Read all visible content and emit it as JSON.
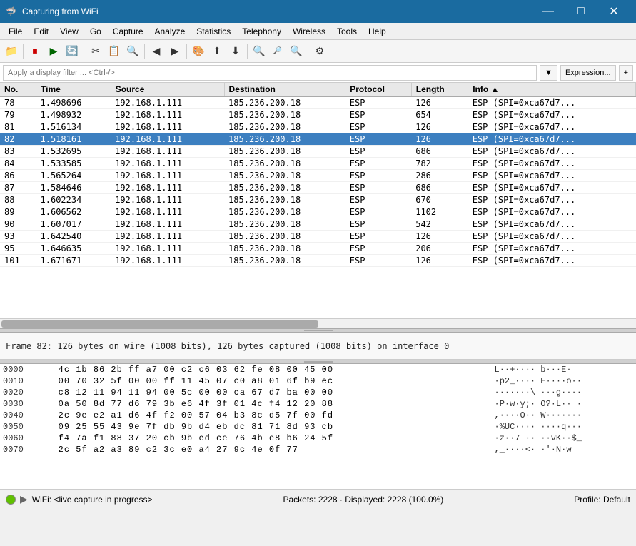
{
  "titlebar": {
    "icon": "🦈",
    "title": "Capturing from WiFi",
    "minimize": "—",
    "maximize": "□",
    "close": "✕"
  },
  "menubar": {
    "items": [
      "File",
      "Edit",
      "View",
      "Go",
      "Capture",
      "Analyze",
      "Statistics",
      "Telephony",
      "Wireless",
      "Tools",
      "Help"
    ]
  },
  "toolbar": {
    "buttons": [
      "📁",
      "⏹",
      "▶",
      "🔄",
      "✂",
      "📋",
      "🔍",
      "⬅",
      "➡",
      "📊",
      "⬆",
      "⬇",
      "📄",
      "◀▶",
      "🔎",
      "🔎",
      "🔎",
      "⚙"
    ]
  },
  "filterbar": {
    "placeholder": "Apply a display filter ... <Ctrl-/>",
    "dropdown_label": "▼",
    "expression_label": "Expression...",
    "plus_label": "+"
  },
  "table": {
    "columns": [
      "No.",
      "Time",
      "Source",
      "Destination",
      "Protocol",
      "Length",
      "Info"
    ],
    "rows": [
      {
        "no": "78",
        "time": "1.498696",
        "src": "192.168.1.111",
        "dst": "185.236.200.18",
        "proto": "ESP",
        "len": "126",
        "info": "ESP (SPI=0xca67d7...",
        "selected": false
      },
      {
        "no": "79",
        "time": "1.498932",
        "src": "192.168.1.111",
        "dst": "185.236.200.18",
        "proto": "ESP",
        "len": "654",
        "info": "ESP (SPI=0xca67d7...",
        "selected": false
      },
      {
        "no": "81",
        "time": "1.516134",
        "src": "192.168.1.111",
        "dst": "185.236.200.18",
        "proto": "ESP",
        "len": "126",
        "info": "ESP (SPI=0xca67d7...",
        "selected": false
      },
      {
        "no": "82",
        "time": "1.518161",
        "src": "192.168.1.111",
        "dst": "185.236.200.18",
        "proto": "ESP",
        "len": "126",
        "info": "ESP (SPI=0xca67d7...",
        "selected": true
      },
      {
        "no": "83",
        "time": "1.532695",
        "src": "192.168.1.111",
        "dst": "185.236.200.18",
        "proto": "ESP",
        "len": "686",
        "info": "ESP (SPI=0xca67d7...",
        "selected": false
      },
      {
        "no": "84",
        "time": "1.533585",
        "src": "192.168.1.111",
        "dst": "185.236.200.18",
        "proto": "ESP",
        "len": "782",
        "info": "ESP (SPI=0xca67d7...",
        "selected": false
      },
      {
        "no": "86",
        "time": "1.565264",
        "src": "192.168.1.111",
        "dst": "185.236.200.18",
        "proto": "ESP",
        "len": "286",
        "info": "ESP (SPI=0xca67d7...",
        "selected": false
      },
      {
        "no": "87",
        "time": "1.584646",
        "src": "192.168.1.111",
        "dst": "185.236.200.18",
        "proto": "ESP",
        "len": "686",
        "info": "ESP (SPI=0xca67d7...",
        "selected": false
      },
      {
        "no": "88",
        "time": "1.602234",
        "src": "192.168.1.111",
        "dst": "185.236.200.18",
        "proto": "ESP",
        "len": "670",
        "info": "ESP (SPI=0xca67d7...",
        "selected": false
      },
      {
        "no": "89",
        "time": "1.606562",
        "src": "192.168.1.111",
        "dst": "185.236.200.18",
        "proto": "ESP",
        "len": "1102",
        "info": "ESP (SPI=0xca67d7...",
        "selected": false
      },
      {
        "no": "90",
        "time": "1.607017",
        "src": "192.168.1.111",
        "dst": "185.236.200.18",
        "proto": "ESP",
        "len": "542",
        "info": "ESP (SPI=0xca67d7...",
        "selected": false
      },
      {
        "no": "93",
        "time": "1.642540",
        "src": "192.168.1.111",
        "dst": "185.236.200.18",
        "proto": "ESP",
        "len": "126",
        "info": "ESP (SPI=0xca67d7...",
        "selected": false
      },
      {
        "no": "95",
        "time": "1.646635",
        "src": "192.168.1.111",
        "dst": "185.236.200.18",
        "proto": "ESP",
        "len": "206",
        "info": "ESP (SPI=0xca67d7...",
        "selected": false
      },
      {
        "no": "101",
        "time": "1.671671",
        "src": "192.168.1.111",
        "dst": "185.236.200.18",
        "proto": "ESP",
        "len": "126",
        "info": "ESP (SPI=0xca67d7...",
        "selected": false
      }
    ]
  },
  "frame_detail": "Frame 82: 126 bytes on wire (1008 bits), 126 bytes captured (1008 bits) on interface 0",
  "hex": {
    "rows": [
      {
        "offset": "0000",
        "bytes": "4c 1b 86 2b ff a7 00 c2  c6 03 62 fe 08 00 45 00",
        "ascii": "L··+····  b···E·"
      },
      {
        "offset": "0010",
        "bytes": "00 70 32 5f 00 00 ff 11  45 07 c0 a8 01 6f b9 ec",
        "ascii": "·p2_····  E····o··"
      },
      {
        "offset": "0020",
        "bytes": "c8 12 11 94 11 94 00 5c  00 00 ca 67 d7 ba 00 00",
        "ascii": "·······\\  ···g····"
      },
      {
        "offset": "0030",
        "bytes": "0a 50 8d 77 d6 79 3b e6  4f 3f 01 4c f4 12 20 88",
        "ascii": "·P·w·y;·  O?·L··  ·"
      },
      {
        "offset": "0040",
        "bytes": "2c 9e e2 a1 d6 4f f2 00  57 04 b3 8c d5 7f 00 fd",
        "ascii": ",····O··  W·······"
      },
      {
        "offset": "0050",
        "bytes": "09 25 55 43 9e 7f db 9b  d4 eb dc 81 71 8d 93 cb",
        "ascii": "·%UC····  ····q···"
      },
      {
        "offset": "0060",
        "bytes": "f4 7a f1 88 37 20 cb 9b  ed ce 76 4b e8 b6 24 5f",
        "ascii": "·z··7 ··  ··vK··$_"
      },
      {
        "offset": "0070",
        "bytes": "2c 5f a2 a3 89 c2 3c e0  a4 27 9c 4e 0f 77",
        "ascii": ",_····<·  ·'·N·w"
      }
    ]
  },
  "statusbar": {
    "wifi_label": "WiFi: <live capture in progress>",
    "packets_label": "Packets: 2228 · Displayed: 2228 (100.0%)",
    "profile_label": "Profile: Default"
  },
  "colors": {
    "selected_row_bg": "#3c7fc0",
    "selected_row_fg": "#ffffff",
    "title_bg": "#1a6ba0"
  }
}
